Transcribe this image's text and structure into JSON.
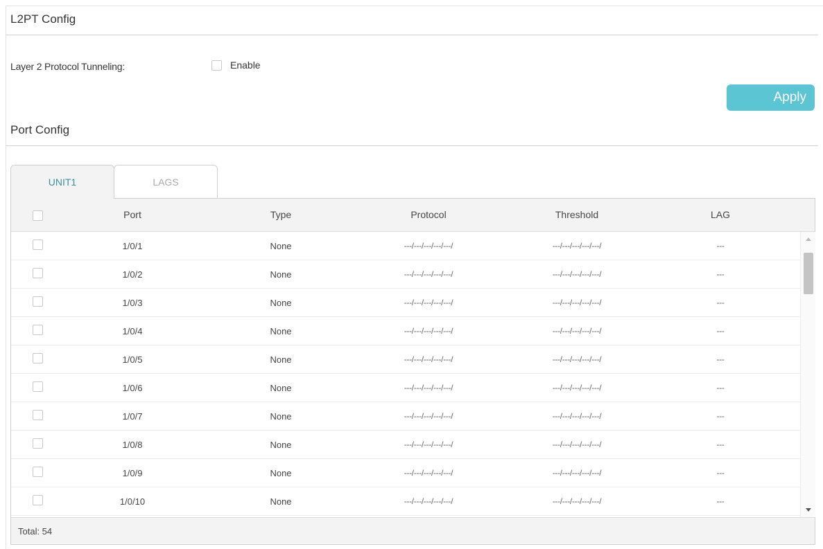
{
  "l2pt": {
    "title": "L2PT Config",
    "tunneling_label": "Layer 2 Protocol Tunneling:",
    "enable_label": "Enable",
    "enable_checked": false,
    "apply_label": "Apply"
  },
  "port": {
    "title": "Port Config",
    "tabs": [
      {
        "label": "UNIT1",
        "active": true
      },
      {
        "label": "LAGS",
        "active": false
      }
    ],
    "columns": {
      "port": "Port",
      "type": "Type",
      "protocol": "Protocol",
      "threshold": "Threshold",
      "lag": "LAG"
    },
    "rows": [
      {
        "port": "1/0/1",
        "type": "None",
        "protocol": "---/---/---/---/---/",
        "threshold": "---/---/---/---/---/",
        "lag": "---"
      },
      {
        "port": "1/0/2",
        "type": "None",
        "protocol": "---/---/---/---/---/",
        "threshold": "---/---/---/---/---/",
        "lag": "---"
      },
      {
        "port": "1/0/3",
        "type": "None",
        "protocol": "---/---/---/---/---/",
        "threshold": "---/---/---/---/---/",
        "lag": "---"
      },
      {
        "port": "1/0/4",
        "type": "None",
        "protocol": "---/---/---/---/---/",
        "threshold": "---/---/---/---/---/",
        "lag": "---"
      },
      {
        "port": "1/0/5",
        "type": "None",
        "protocol": "---/---/---/---/---/",
        "threshold": "---/---/---/---/---/",
        "lag": "---"
      },
      {
        "port": "1/0/6",
        "type": "None",
        "protocol": "---/---/---/---/---/",
        "threshold": "---/---/---/---/---/",
        "lag": "---"
      },
      {
        "port": "1/0/7",
        "type": "None",
        "protocol": "---/---/---/---/---/",
        "threshold": "---/---/---/---/---/",
        "lag": "---"
      },
      {
        "port": "1/0/8",
        "type": "None",
        "protocol": "---/---/---/---/---/",
        "threshold": "---/---/---/---/---/",
        "lag": "---"
      },
      {
        "port": "1/0/9",
        "type": "None",
        "protocol": "---/---/---/---/---/",
        "threshold": "---/---/---/---/---/",
        "lag": "---"
      },
      {
        "port": "1/0/10",
        "type": "None",
        "protocol": "---/---/---/---/---/",
        "threshold": "---/---/---/---/---/",
        "lag": "---"
      }
    ],
    "total_label": "Total: 54"
  },
  "icons": {
    "scroll_up": "chevron-up-icon",
    "scroll_down": "chevron-down-icon"
  },
  "colors": {
    "accent": "#5bc5d3",
    "active_tab_text": "#3a8f9b"
  }
}
